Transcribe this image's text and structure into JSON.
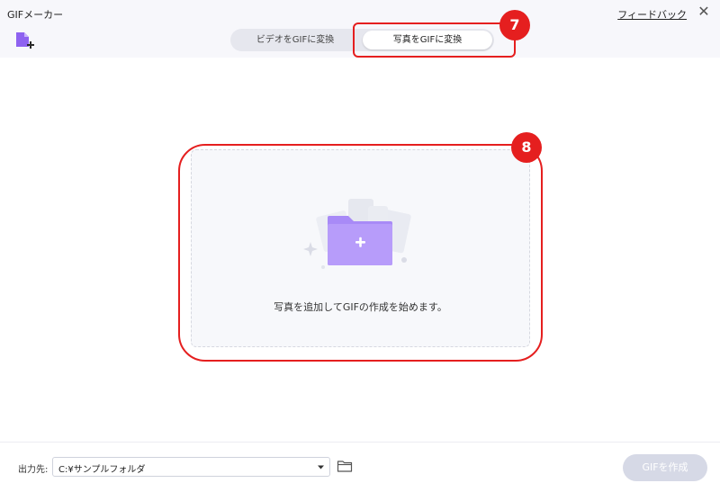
{
  "window": {
    "title": "GIFメーカー",
    "feedback_label": "フィードバック",
    "close_glyph": "✕"
  },
  "toolbar": {
    "add_icon": "add-file-icon"
  },
  "tabs": [
    {
      "label": "ビデオをGIFに変換",
      "selected": false
    },
    {
      "label": "写真をGIFに変換",
      "selected": true
    }
  ],
  "annotations": {
    "badge7": "7",
    "badge8": "8"
  },
  "dropzone": {
    "text": "写真を追加してGIFの作成を始めます。",
    "icon": "folder-plus-icon"
  },
  "footer": {
    "output_label": "出力先:",
    "output_value": "C:¥サンプルフォルダ",
    "create_label": "GIFを作成"
  },
  "colors": {
    "accent": "#a07cf5",
    "annotation": "#e51f1f",
    "create_button_disabled": "#d6d9e6"
  }
}
